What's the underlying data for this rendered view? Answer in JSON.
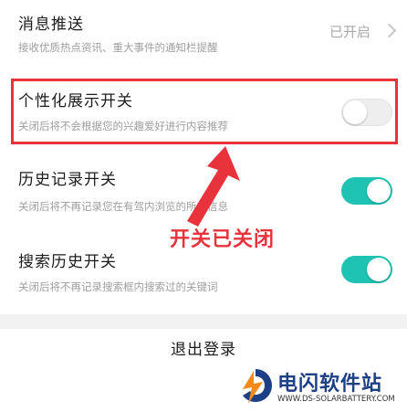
{
  "settings": {
    "push": {
      "title": "消息推送",
      "desc": "接收优质热点资讯、重大事件的通知栏提醒",
      "value": "已开启"
    },
    "personalized": {
      "title": "个性化展示开关",
      "desc": "关闭后将不会根据您的兴趣爱好进行内容推荐",
      "enabled": false
    },
    "history": {
      "title": "历史记录开关",
      "desc": "关闭后将不再记录您在有驾内浏览的所有信息",
      "enabled": true
    },
    "search_history": {
      "title": "搜索历史开关",
      "desc": "关闭后将不再记录搜索框内搜索过的关键词",
      "enabled": true
    }
  },
  "logout_label": "退出登录",
  "annotation": {
    "text": "开关已关闭"
  },
  "watermark": {
    "name": "电闪软件站",
    "url": "WWW.DS-SOLARBATTERY.COM"
  },
  "colors": {
    "toggle_on": "#1ec3b3",
    "highlight": "#e8323c",
    "brand": "#1d3f85"
  }
}
